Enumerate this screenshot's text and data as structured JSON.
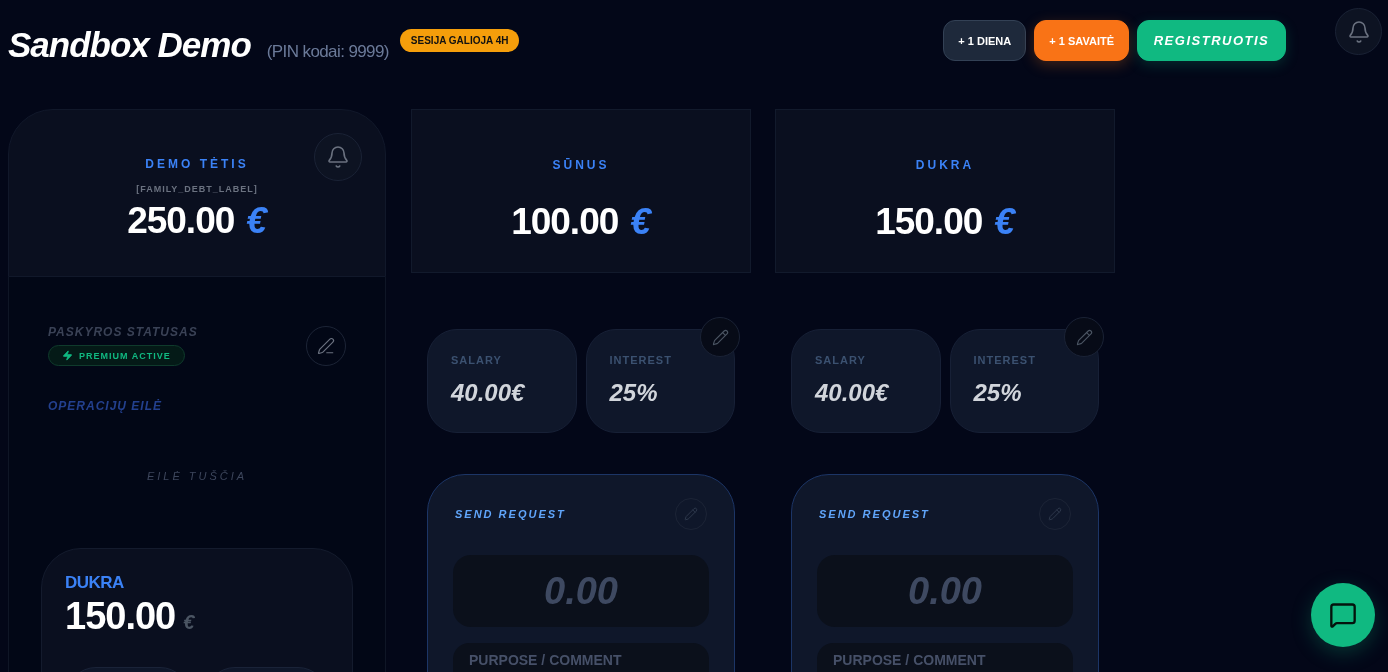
{
  "header": {
    "title": "Sandbox Demo",
    "pin_note": "(PIN kodai: 9999)",
    "session_badge": "SESIJA GALIOJA 4H",
    "buttons": [
      {
        "label": "+ 1 DIENA",
        "kind": "neutral"
      },
      {
        "label": "+ 1 SAVAITĖ",
        "kind": "warning"
      },
      {
        "label": "REGISTRUOTIS",
        "kind": "primary"
      }
    ]
  },
  "parent_panel": {
    "name": "DEMO TĖTIS",
    "debt_label": "[FAMILY_DEBT_LABEL]",
    "amount": "250.00",
    "currency": "€",
    "status_label": "PASKYROS STATUSAS",
    "status_badge": "PREMIUM ACTIVE",
    "queue_title": "OPERACIJŲ EILĖ",
    "queue_empty": "EILĖ TUŠČIA",
    "child_summaries": [
      {
        "name": "DUKRA",
        "amount": "150.00",
        "currency": "€"
      }
    ]
  },
  "children": [
    {
      "name": "SŪNUS",
      "amount": "100.00",
      "currency": "€",
      "stats": [
        {
          "label": "SALARY",
          "value": "40.00€"
        },
        {
          "label": "INTEREST",
          "value": "25%"
        }
      ],
      "request": {
        "title": "SEND REQUEST",
        "amount_placeholder": "0.00",
        "comment_placeholder": "PURPOSE / COMMENT"
      }
    },
    {
      "name": "DUKRA",
      "amount": "150.00",
      "currency": "€",
      "stats": [
        {
          "label": "SALARY",
          "value": "40.00€"
        },
        {
          "label": "INTEREST",
          "value": "25%"
        }
      ],
      "request": {
        "title": "SEND REQUEST",
        "amount_placeholder": "0.00",
        "comment_placeholder": "PURPOSE / COMMENT"
      }
    }
  ]
}
